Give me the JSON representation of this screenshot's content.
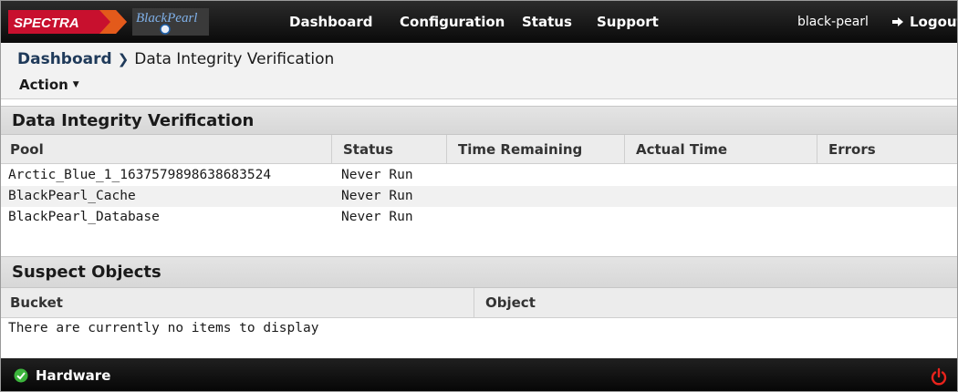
{
  "header": {
    "logo_brand": "SPECTRA",
    "logo_product": "BlackPearl",
    "nav": {
      "dashboard": "Dashboard",
      "configuration": "Configuration",
      "status": "Status",
      "support": "Support"
    },
    "user": "black-pearl",
    "logout": "Logout"
  },
  "breadcrumb": {
    "root": "Dashboard",
    "current": "Data Integrity Verification"
  },
  "action_menu": "Action",
  "verification": {
    "title": "Data Integrity Verification",
    "columns": [
      "Pool",
      "Status",
      "Time Remaining",
      "Actual Time",
      "Errors"
    ],
    "rows": [
      {
        "pool": "Arctic_Blue_1_1637579898638683524",
        "status": "Never Run",
        "time_remaining": "",
        "actual_time": "",
        "errors": ""
      },
      {
        "pool": "BlackPearl_Cache",
        "status": "Never Run",
        "time_remaining": "",
        "actual_time": "",
        "errors": ""
      },
      {
        "pool": "BlackPearl_Database",
        "status": "Never Run",
        "time_remaining": "",
        "actual_time": "",
        "errors": ""
      }
    ]
  },
  "suspect": {
    "title": "Suspect Objects",
    "columns": [
      "Bucket",
      "Object"
    ],
    "empty_message": "There are currently no items to display"
  },
  "footer": {
    "hardware": "Hardware",
    "hardware_status_color": "#3cb43c",
    "power_color": "#e8231c"
  },
  "colors": {
    "topbar": "#111111",
    "logo_red": "#c8102e",
    "logo_blue": "#1d5fa8",
    "link": "#1f3a5a"
  }
}
